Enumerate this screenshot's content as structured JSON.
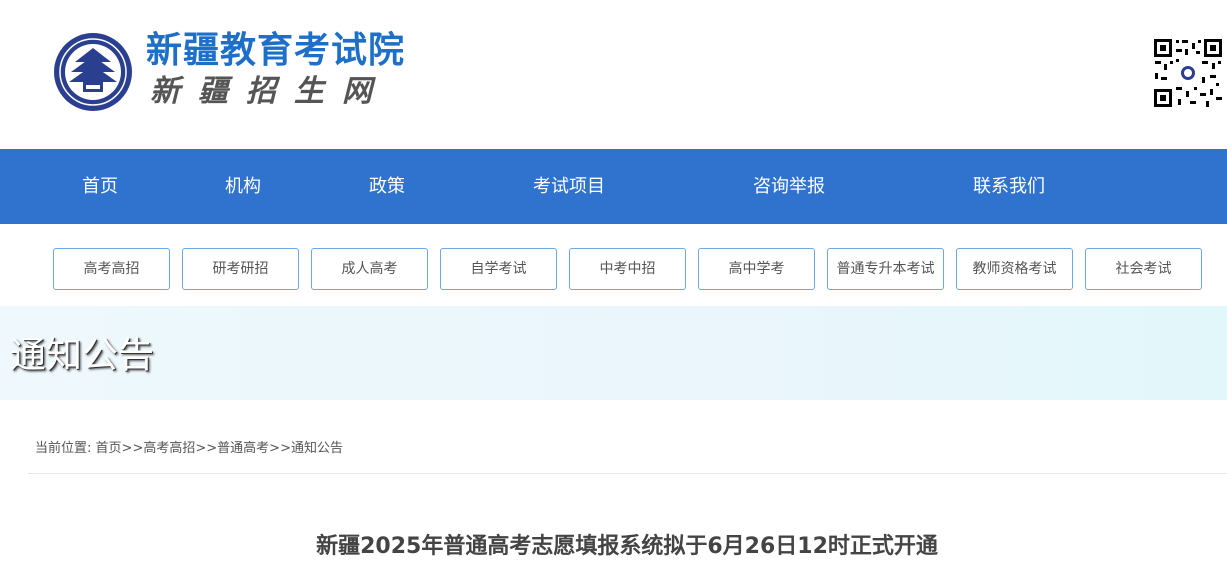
{
  "header": {
    "title": "新疆教育考试院",
    "subtitle": "新疆招生网",
    "logo_icon": "education-exam-emblem",
    "qr_icon": "qr-code"
  },
  "nav": {
    "items": [
      "首页",
      "机构",
      "政策",
      "考试项目",
      "咨询举报",
      "联系我们"
    ]
  },
  "categories": [
    "高考高招",
    "研考研招",
    "成人高考",
    "自学考试",
    "中考中招",
    "高中学考",
    "普通专升本考试",
    "教师资格考试",
    "社会考试"
  ],
  "banner": {
    "title": "通知公告"
  },
  "breadcrumb": {
    "prefix": "当前位置:",
    "items": [
      "首页",
      "高考高招",
      "普通高考",
      "通知公告"
    ],
    "separator": ">>"
  },
  "article": {
    "title": "新疆2025年普通高考志愿填报系统拟于6月26日12时正式开通"
  },
  "colors": {
    "brand_blue": "#1e6fc7",
    "nav_bg": "#2f73cf",
    "button_border": "#6ea6e6"
  }
}
